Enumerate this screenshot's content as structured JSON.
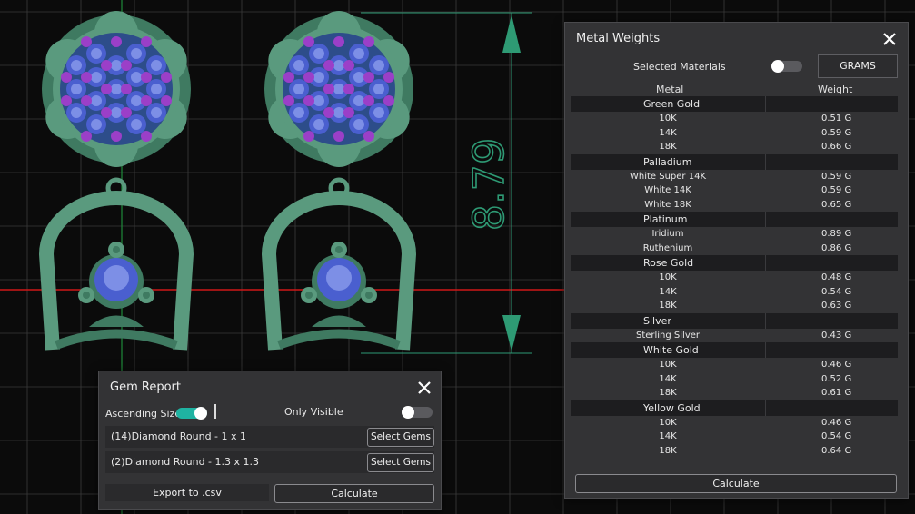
{
  "viewport": {
    "dimension_value": "8.79"
  },
  "metal_weights": {
    "title": "Metal Weights",
    "selected_materials_label": "Selected Materials",
    "selected_materials_on": false,
    "units_button": "GRAMS",
    "columns": {
      "metal": "Metal",
      "weight": "Weight"
    },
    "groups": [
      {
        "name": "Green Gold",
        "rows": [
          {
            "metal": "10K",
            "weight": "0.51 G"
          },
          {
            "metal": "14K",
            "weight": "0.59 G"
          },
          {
            "metal": "18K",
            "weight": "0.66 G"
          }
        ]
      },
      {
        "name": "Palladium",
        "rows": [
          {
            "metal": "White Super 14K",
            "weight": "0.59 G"
          },
          {
            "metal": "White 14K",
            "weight": "0.59 G"
          },
          {
            "metal": "White 18K",
            "weight": "0.65 G"
          }
        ]
      },
      {
        "name": "Platinum",
        "rows": [
          {
            "metal": "Iridium",
            "weight": "0.89 G"
          },
          {
            "metal": "Ruthenium",
            "weight": "0.86 G"
          }
        ]
      },
      {
        "name": "Rose Gold",
        "rows": [
          {
            "metal": "10K",
            "weight": "0.48 G"
          },
          {
            "metal": "14K",
            "weight": "0.54 G"
          },
          {
            "metal": "18K",
            "weight": "0.63 G"
          }
        ]
      },
      {
        "name": "Silver",
        "rows": [
          {
            "metal": "Sterling Silver",
            "weight": "0.43 G"
          }
        ]
      },
      {
        "name": "White Gold",
        "rows": [
          {
            "metal": "10K",
            "weight": "0.46 G"
          },
          {
            "metal": "14K",
            "weight": "0.52 G"
          },
          {
            "metal": "18K",
            "weight": "0.61 G"
          }
        ]
      },
      {
        "name": "Yellow Gold",
        "rows": [
          {
            "metal": "10K",
            "weight": "0.46 G"
          },
          {
            "metal": "14K",
            "weight": "0.54 G"
          },
          {
            "metal": "18K",
            "weight": "0.64 G"
          }
        ]
      }
    ],
    "calculate_label": "Calculate"
  },
  "gem_report": {
    "title": "Gem Report",
    "ascending_size_label": "Ascending Size",
    "ascending_size_on": true,
    "only_visible_label": "Only Visible",
    "only_visible_on": false,
    "gems": [
      {
        "label": "(14)Diamond Round - 1 x 1",
        "button": "Select Gems"
      },
      {
        "label": "(2)Diamond Round - 1.3 x 1.3",
        "button": "Select Gems"
      }
    ],
    "export_label": "Export to .csv",
    "calculate_label": "Calculate"
  },
  "colors": {
    "background": "#0b0b0b",
    "grid": "#3a3a3a",
    "metal_green": "#5a9a7e",
    "metal_green_dark": "#3f7a61",
    "gem_blue": "#4a5fcf",
    "gem_blue_light": "#7d8fe6",
    "gem_purple": "#9b3fc8",
    "dimension_green": "#2e9a74",
    "axis_red": "#d01818",
    "toggle_on": "#1fb3a2"
  }
}
